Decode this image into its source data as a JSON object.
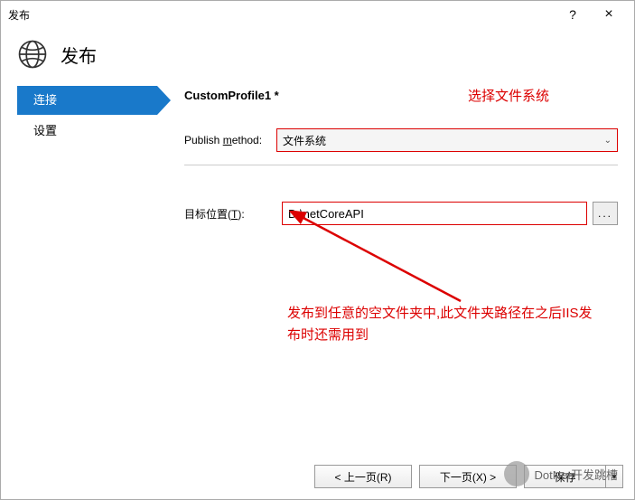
{
  "window": {
    "title": "发布",
    "help": "?",
    "close": "×"
  },
  "header": {
    "page_title": "发布"
  },
  "sidebar": {
    "items": [
      {
        "label": "连接"
      },
      {
        "label": "设置"
      }
    ]
  },
  "form": {
    "profile_name": "CustomProfile1 *",
    "annotation_top": "选择文件系统",
    "publish_method_label_prefix": "Publish ",
    "publish_method_label_ul": "m",
    "publish_method_label_suffix": "ethod:",
    "publish_method_value": "文件系统",
    "target_label_prefix": "目标位置(",
    "target_label_ul": "T",
    "target_label_suffix": "):",
    "target_value": "D:\\netCoreAPI",
    "browse_label": "...",
    "annotation_bottom": "发布到任意的空文件夹中,此文件夹路径在之后IIS发布时还需用到"
  },
  "buttons": {
    "prev": "< 上一页(R)",
    "next": "下一页(X) >",
    "save": "保存",
    "drop": "▼"
  },
  "watermark": {
    "text": "DotNet开发跳槽"
  }
}
